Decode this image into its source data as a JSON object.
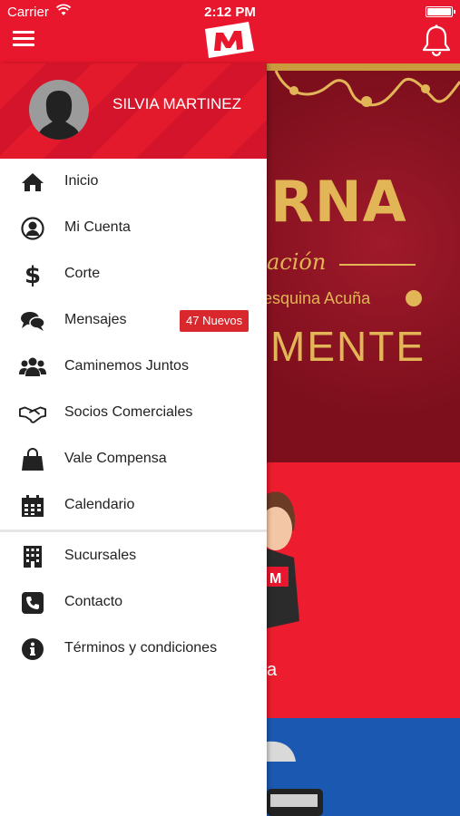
{
  "status_bar": {
    "carrier": "Carrier",
    "time": "2:12 PM"
  },
  "nav": {
    "logo_icon": "m-logo-icon",
    "menu_icon": "hamburger-icon",
    "notification_icon": "bell-icon"
  },
  "drawer": {
    "user_name": "SILVIA MARTINEZ",
    "items": [
      {
        "label": "Inicio",
        "icon": "home-icon"
      },
      {
        "label": "Mi Cuenta",
        "icon": "user-circle-icon"
      },
      {
        "label": "Corte",
        "icon": "dollar-icon"
      },
      {
        "label": "Mensajes",
        "icon": "chat-icon",
        "badge": "47 Nuevos"
      },
      {
        "label": "Caminemos Juntos",
        "icon": "group-icon"
      },
      {
        "label": "Socios Comerciales",
        "icon": "handshake-icon"
      },
      {
        "label": "Vale Compensa",
        "icon": "shopping-bag-icon"
      },
      {
        "label": "Calendario",
        "icon": "calendar-icon"
      }
    ],
    "items_secondary": [
      {
        "label": "Sucursales",
        "icon": "building-icon"
      },
      {
        "label": "Contacto",
        "icon": "phone-icon"
      },
      {
        "label": "Términos y condiciones",
        "icon": "info-icon"
      }
    ]
  },
  "background": {
    "banner_title": "RNA",
    "banner_script": "ación",
    "banner_address": "esquina Acuña",
    "banner_word": "MENTE",
    "panel_text": "a"
  },
  "colors": {
    "brand_red": "#e8172d",
    "badge_red": "#d9272e",
    "gold": "#e2b556",
    "banner_maroon": "#7d0f1d",
    "panel_blue": "#1b58b1"
  }
}
